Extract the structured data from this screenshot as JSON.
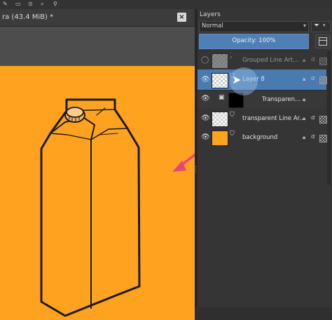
{
  "document": {
    "title": "ra (43.4 MiB) *",
    "close_glyph": "×"
  },
  "toolbar": {
    "tools": [
      "✎",
      "▭",
      "⊙",
      "⌕",
      "⚲"
    ]
  },
  "layers_panel": {
    "title": "Layers",
    "blend_mode": "Normal",
    "opacity_label": "Opacity:  100%",
    "filter_icon": "filter-icon",
    "layers": [
      {
        "name": "Grouped Line Art...",
        "visible": true,
        "selected": false,
        "type": "group"
      },
      {
        "name": "Layer 8",
        "visible": true,
        "selected": true,
        "type": "paint"
      },
      {
        "name": "Transparen...",
        "visible": true,
        "selected": false,
        "type": "transparency-mask"
      },
      {
        "name": "transparent Line Ar...",
        "visible": true,
        "selected": false,
        "type": "paint"
      },
      {
        "name": "background",
        "visible": true,
        "selected": false,
        "type": "paint"
      }
    ]
  },
  "colors": {
    "canvas_fill": "#ffa21f",
    "selection": "#4a7bb0",
    "arrow": "#e8467a"
  }
}
